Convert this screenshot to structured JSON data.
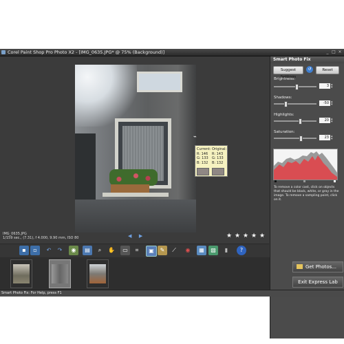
{
  "window": {
    "title": "Corel Paint Shop Pro Photo X2 - [IMG_0635.JPG* @ 75% (Background)]",
    "controls": [
      "_",
      "□",
      "×"
    ]
  },
  "photo_info": {
    "filename": "IMG_0635.JPG",
    "details": "1/159 sec., (7.31), f 4.000, 9.90 mm, ISO 80"
  },
  "rating_stars": [
    "★",
    "★",
    "★",
    "★",
    "★"
  ],
  "pixel_tooltip": {
    "current_label": "Current:",
    "original_label": "Original:",
    "current": [
      "R: 146",
      "G: 133",
      "B: 132"
    ],
    "original": [
      "R: 143",
      "G: 133",
      "B: 132"
    ]
  },
  "toolbar": {
    "icons": [
      "save-icon",
      "save-as-icon",
      "undo-icon",
      "redo-icon",
      "print-icon",
      "zoom-icon",
      "pan-icon",
      "crop-icon",
      "smart-photo-fix-icon",
      "red-eye-icon",
      "makeover-icon",
      "delete-icon",
      "help-icon"
    ]
  },
  "panel": {
    "title": "Smart Photo Fix",
    "suggest_button": "Suggest Settings",
    "reset_button": "Reset",
    "sliders": [
      {
        "label": "Brightness:",
        "value": "3"
      },
      {
        "label": "Shadows:",
        "value": "-50"
      },
      {
        "label": "Highlights:",
        "value": "20"
      },
      {
        "label": "Saturation:",
        "value": "23"
      }
    ],
    "help_text": "To remove a color cast, click on objects that should be black, white, or gray in the image. To remove a sampling point, click on it."
  },
  "side_buttons": {
    "get_photos": "Get Photos...",
    "exit": "Exit Express Lab"
  },
  "status": {
    "text": "Smart Photo Fix: For Help, press F1"
  },
  "colors": {
    "accent": "#6fa0e0",
    "histogram_red": "#e0454a",
    "histogram_gray": "#9a9a9a"
  }
}
